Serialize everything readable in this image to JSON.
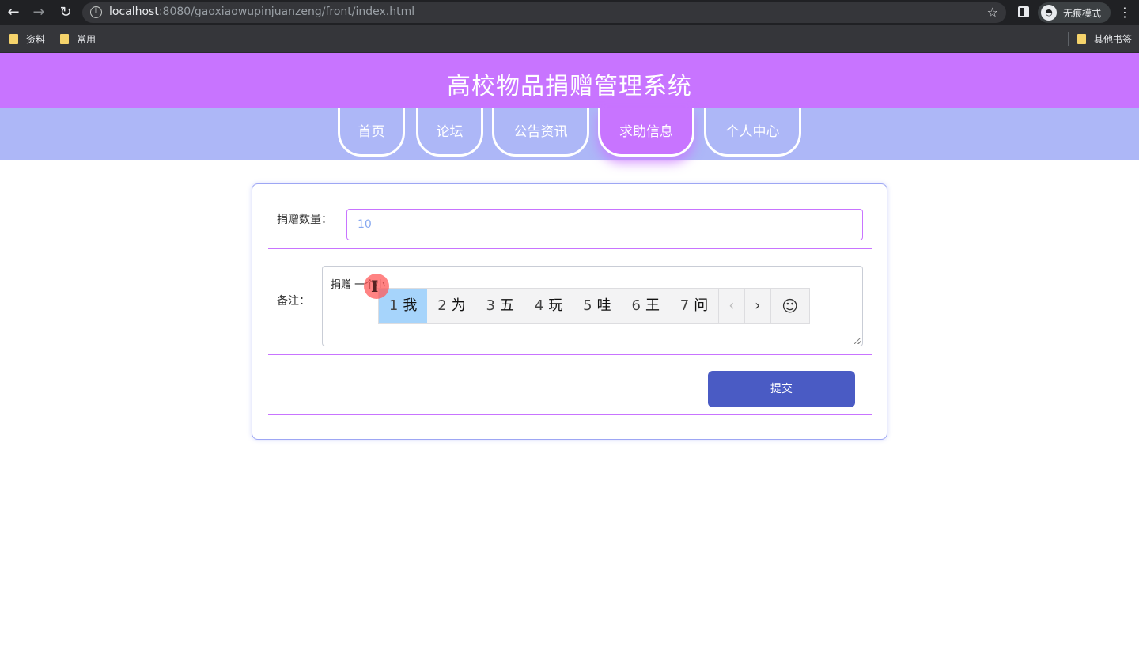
{
  "browser": {
    "url_host": "localhost",
    "url_rest": ":8080/gaoxiaowupinjuanzeng/front/index.html",
    "incognito_label": "无痕模式",
    "bookmarks": [
      "资料",
      "常用"
    ],
    "other_bookmarks": "其他书签"
  },
  "site": {
    "title": "高校物品捐赠管理系统"
  },
  "nav": {
    "tabs": [
      "首页",
      "论坛",
      "公告资讯",
      "求助信息",
      "个人中心"
    ],
    "active_index": 3
  },
  "form": {
    "quantity_label": "捐赠数量：",
    "quantity_value": "10",
    "remark_label": "备注：",
    "remark_value": "捐赠 一个小",
    "submit_label": "提交"
  },
  "ime": {
    "candidates": [
      {
        "num": "1",
        "word": "我"
      },
      {
        "num": "2",
        "word": "为"
      },
      {
        "num": "3",
        "word": "五"
      },
      {
        "num": "4",
        "word": "玩"
      },
      {
        "num": "5",
        "word": "哇"
      },
      {
        "num": "6",
        "word": "王"
      },
      {
        "num": "7",
        "word": "问"
      }
    ],
    "selected_index": 0
  },
  "colors": {
    "header_bg": "#c874ff",
    "navbar_bg": "#adb7f7",
    "submit_bg": "#4a5bc4",
    "ime_selected": "#a6d4fb"
  }
}
